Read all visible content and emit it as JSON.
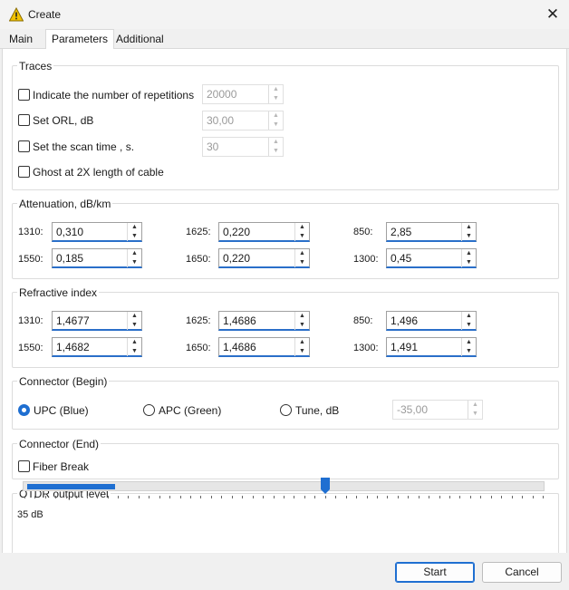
{
  "window": {
    "title": "Create",
    "icon": "warning-icon",
    "close_icon": "close-icon"
  },
  "tabs": [
    {
      "label": "Main",
      "active": false
    },
    {
      "label": "Parameters",
      "active": true
    },
    {
      "label": "Additional",
      "active": false
    }
  ],
  "traces": {
    "title": "Traces",
    "rows": [
      {
        "label": "Indicate the number of repetitions",
        "checked": false,
        "value": "20000"
      },
      {
        "label": "Set ORL, dB",
        "checked": false,
        "value": "30,00"
      },
      {
        "label": "Set the scan time , s.",
        "checked": false,
        "value": "30"
      },
      {
        "label": "Ghost at 2X length of cable",
        "checked": false
      }
    ]
  },
  "attenuation": {
    "title": "Attenuation,  dB/km",
    "fields": [
      {
        "label": "1310:",
        "value": "0,310"
      },
      {
        "label": "1625:",
        "value": "0,220"
      },
      {
        "label": "850:",
        "value": "2,85"
      },
      {
        "label": "1550:",
        "value": "0,185"
      },
      {
        "label": "1650:",
        "value": "0,220"
      },
      {
        "label": "1300:",
        "value": "0,45"
      }
    ]
  },
  "refractive": {
    "title": "Refractive index",
    "fields": [
      {
        "label": "1310:",
        "value": "1,4677"
      },
      {
        "label": "1625:",
        "value": "1,4686"
      },
      {
        "label": "850:",
        "value": "1,496"
      },
      {
        "label": "1550:",
        "value": "1,4682"
      },
      {
        "label": "1650:",
        "value": "1,4686"
      },
      {
        "label": "1300:",
        "value": "1,491"
      }
    ]
  },
  "connector_begin": {
    "title": "Connector (Begin)",
    "options": [
      {
        "label": "UPC (Blue)",
        "selected": true
      },
      {
        "label": "APC (Green)",
        "selected": false
      },
      {
        "label": "Tune,  dB",
        "selected": false
      }
    ],
    "tune_value": "-35,00"
  },
  "connector_end": {
    "title": "Connector (End)",
    "fiber_break_label": "Fiber Break",
    "fiber_break_checked": false
  },
  "otdr": {
    "title": "OTDR output level",
    "level_text": "35 dB",
    "slider_fraction": 0.58,
    "fill_fraction": 0.17
  },
  "buttons": {
    "start": "Start",
    "cancel": "Cancel"
  },
  "colors": {
    "accent": "#1f6fd1",
    "warning": "#f2c200"
  }
}
